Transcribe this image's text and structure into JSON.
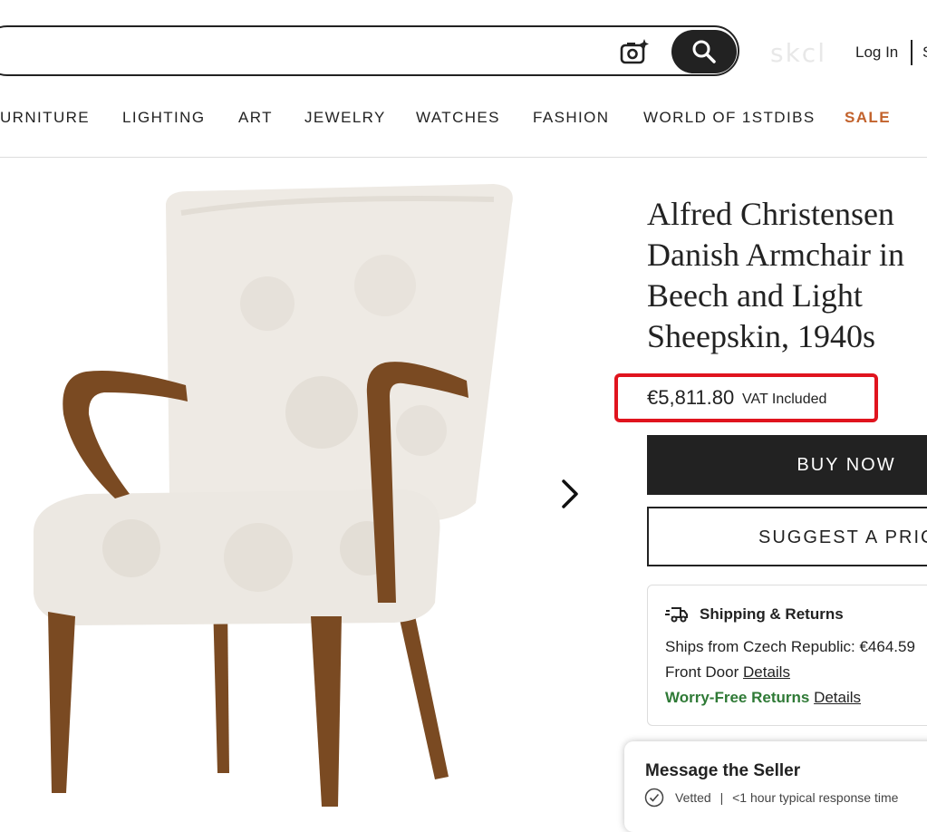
{
  "header": {
    "brand_watermark": "skcl",
    "login_label": "Log In",
    "signup_label": "S",
    "search_icon": "magnifier-icon",
    "camera_icon": "camera-sparkle-icon"
  },
  "nav": {
    "items": [
      "URNITURE",
      "LIGHTING",
      "ART",
      "JEWELRY",
      "WATCHES",
      "FASHION",
      "WORLD OF 1STDIBS",
      "SALE"
    ]
  },
  "product": {
    "title": "Alfred Christensen Danish Armchair in Beech and Light Sheepskin, 1940s",
    "price": "€5,811.80",
    "vat": "VAT Included",
    "buy_label": "BUY NOW",
    "suggest_label": "SUGGEST A PRICE",
    "next_icon": "chevron-right-icon"
  },
  "shipping": {
    "heading": "Shipping & Returns",
    "ships_from": "Ships from Czech Republic: €464.59",
    "front_door": "Front Door",
    "details_label": "Details",
    "worry_free": "Worry-Free Returns",
    "details_label_2": "Details"
  },
  "message": {
    "title": "Message the Seller",
    "vetted": "Vetted",
    "separator": "|",
    "response": "<1 hour typical response time"
  },
  "colors": {
    "accent_sale": "#c2622c",
    "highlight_box": "#e0141e",
    "green": "#2f7a36",
    "dark": "#222222"
  }
}
